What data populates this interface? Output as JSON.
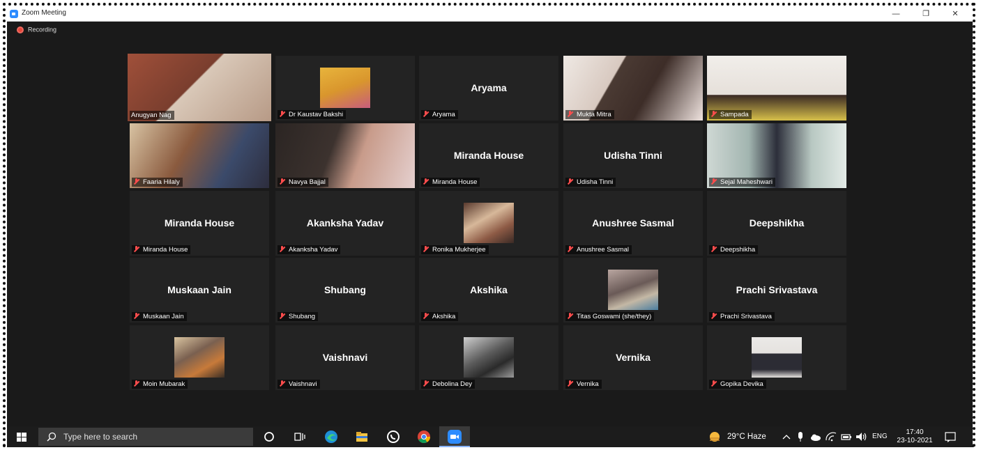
{
  "window": {
    "title": "Zoom Meeting",
    "minimize": "—",
    "restore": "❐",
    "close": "✕"
  },
  "recording": {
    "label": "Recording"
  },
  "participants": [
    {
      "name": "Anugyan Nag",
      "display": "",
      "video": true
    },
    {
      "name": "Dr Kaustav Bakshi",
      "display": "",
      "video": true
    },
    {
      "name": "Aryama",
      "display": "Aryama",
      "video": false
    },
    {
      "name": "Mukta Mitra",
      "display": "",
      "video": true
    },
    {
      "name": "Sampada",
      "display": "",
      "video": true
    },
    {
      "name": "Faaria Hilaly",
      "display": "",
      "video": true
    },
    {
      "name": "Navya Bajjal",
      "display": "",
      "video": true
    },
    {
      "name": "Miranda House",
      "display": "Miranda House",
      "video": false
    },
    {
      "name": "Udisha Tinni",
      "display": "Udisha Tinni",
      "video": false
    },
    {
      "name": "Sejal Maheshwari",
      "display": "",
      "video": true
    },
    {
      "name": "Miranda House",
      "display": "Miranda House",
      "video": false
    },
    {
      "name": "Akanksha Yadav",
      "display": "Akanksha Yadav",
      "video": false
    },
    {
      "name": "Ronika Mukherjee",
      "display": "",
      "video": true
    },
    {
      "name": "Anushree Sasmal",
      "display": "Anushree Sasmal",
      "video": false
    },
    {
      "name": "Deepshikha",
      "display": "Deepshikha",
      "video": false
    },
    {
      "name": "Muskaan Jain",
      "display": "Muskaan Jain",
      "video": false
    },
    {
      "name": "Shubang",
      "display": "Shubang",
      "video": false
    },
    {
      "name": "Akshika",
      "display": "Akshika",
      "video": false
    },
    {
      "name": "Titas Goswami (she/they)",
      "display": "",
      "video": true
    },
    {
      "name": "Prachi Srivastava",
      "display": "Prachi Srivastava",
      "video": false
    },
    {
      "name": "Moin Mubarak",
      "display": "",
      "video": true
    },
    {
      "name": "Vaishnavi",
      "display": "Vaishnavi",
      "video": false
    },
    {
      "name": "Debolina Dey",
      "display": "",
      "video": true
    },
    {
      "name": "Vernika",
      "display": "Vernika",
      "video": false
    },
    {
      "name": "Gopika Devika",
      "display": "",
      "video": true
    }
  ],
  "taskbar": {
    "search_placeholder": "Type here to search",
    "weather": "29°C  Haze",
    "language": "ENG",
    "time": "17:40",
    "date": "23-10-2021"
  },
  "colors": {
    "active_speaker": "#c9e34b",
    "mic_muted": "#ff4d4d",
    "tile_bg": "#232323"
  }
}
